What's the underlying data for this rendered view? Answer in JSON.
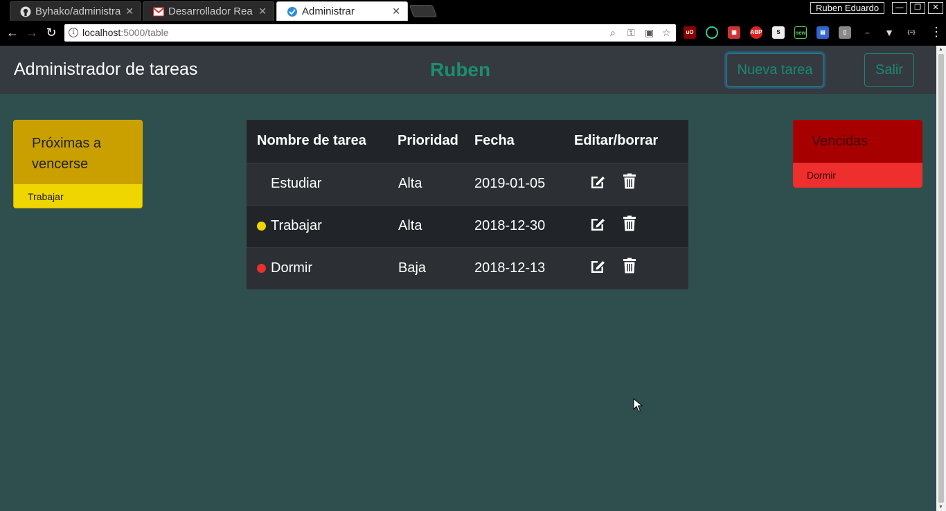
{
  "browser": {
    "tabs": [
      {
        "title": "Byhako/administra",
        "icon": "github-icon",
        "active": false
      },
      {
        "title": "Desarrollador Rea",
        "icon": "gmail-icon",
        "active": false
      },
      {
        "title": "Administrar",
        "icon": "app-favicon-icon",
        "active": true
      }
    ],
    "profile_name": "Ruben Eduardo",
    "url_host": "localhost",
    "url_path": ":5000/table"
  },
  "app": {
    "brand": "Administrador de tareas",
    "username": "Ruben",
    "new_task_label": "Nueva tarea",
    "exit_label": "Salir",
    "accent_color": "#1a8a74"
  },
  "upcoming": {
    "title": "Próximas a vencerse",
    "items": [
      "Trabajar"
    ],
    "color": "#c9a000"
  },
  "overdue": {
    "title": "Vencidas",
    "items": [
      "Dormir"
    ],
    "color": "#a70000"
  },
  "table": {
    "headers": [
      "Nombre de tarea",
      "Prioridad",
      "Fecha",
      "Editar/borrar"
    ],
    "rows": [
      {
        "name": "Estudiar",
        "priority": "Alta",
        "date": "2019-01-05",
        "status": "none"
      },
      {
        "name": "Trabajar",
        "priority": "Alta",
        "date": "2018-12-30",
        "status": "upcoming"
      },
      {
        "name": "Dormir",
        "priority": "Baja",
        "date": "2018-12-13",
        "status": "overdue"
      }
    ],
    "status_colors": {
      "upcoming": "#f0d400",
      "overdue": "#e8302f"
    }
  }
}
